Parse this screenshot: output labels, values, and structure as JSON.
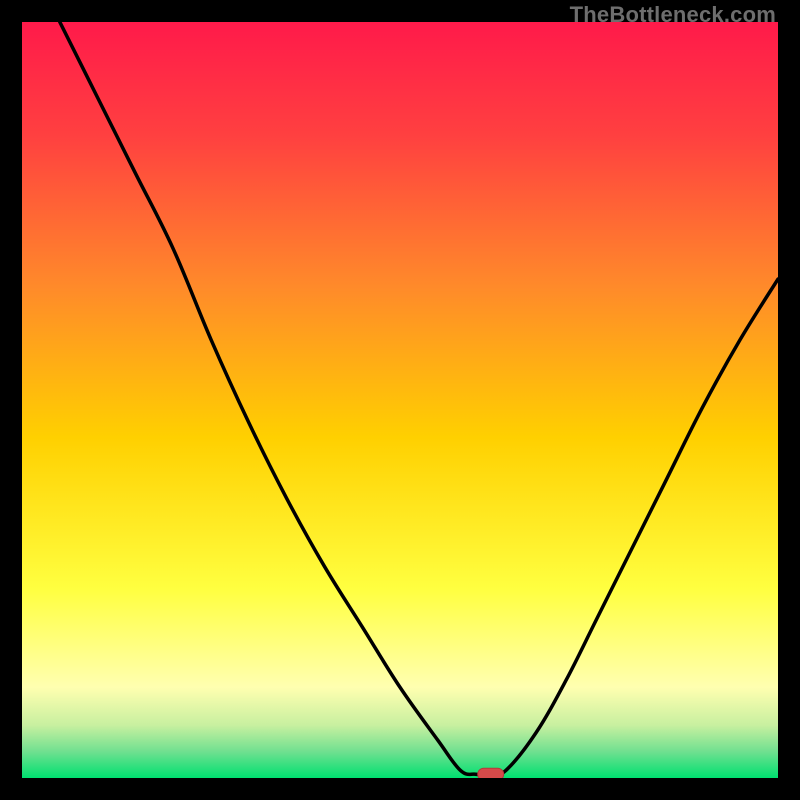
{
  "watermark": "TheBottleneck.com",
  "colors": {
    "black": "#000000",
    "curve": "#000000",
    "marker_fill": "#d64a4a",
    "marker_stroke": "#b23a3a",
    "grad_top": "#ff1a4a",
    "grad_mid1": "#ff6a3a",
    "grad_mid2": "#ffd000",
    "grad_yellow": "#ffff40",
    "grad_paleyellow": "#ffffb0",
    "grad_lightgreen": "#9de89d",
    "grad_green": "#00e070"
  },
  "chart_data": {
    "type": "line",
    "title": "",
    "xlabel": "",
    "ylabel": "",
    "xlim": [
      0,
      100
    ],
    "ylim": [
      0,
      100
    ],
    "curve": [
      {
        "x": 5,
        "y": 100
      },
      {
        "x": 10,
        "y": 90
      },
      {
        "x": 15,
        "y": 80
      },
      {
        "x": 20,
        "y": 70
      },
      {
        "x": 25,
        "y": 58
      },
      {
        "x": 30,
        "y": 47
      },
      {
        "x": 35,
        "y": 37
      },
      {
        "x": 40,
        "y": 28
      },
      {
        "x": 45,
        "y": 20
      },
      {
        "x": 50,
        "y": 12
      },
      {
        "x": 55,
        "y": 5
      },
      {
        "x": 58,
        "y": 1
      },
      {
        "x": 60,
        "y": 0.5
      },
      {
        "x": 62,
        "y": 0.5
      },
      {
        "x": 64,
        "y": 1
      },
      {
        "x": 68,
        "y": 6
      },
      {
        "x": 72,
        "y": 13
      },
      {
        "x": 76,
        "y": 21
      },
      {
        "x": 80,
        "y": 29
      },
      {
        "x": 85,
        "y": 39
      },
      {
        "x": 90,
        "y": 49
      },
      {
        "x": 95,
        "y": 58
      },
      {
        "x": 100,
        "y": 66
      }
    ],
    "marker": {
      "x": 62,
      "y": 0.5
    },
    "gradient_stops": [
      {
        "pos": 0.0,
        "color": "#ff1a4a"
      },
      {
        "pos": 0.15,
        "color": "#ff4040"
      },
      {
        "pos": 0.35,
        "color": "#ff8a2a"
      },
      {
        "pos": 0.55,
        "color": "#ffd000"
      },
      {
        "pos": 0.75,
        "color": "#ffff40"
      },
      {
        "pos": 0.88,
        "color": "#ffffb0"
      },
      {
        "pos": 0.93,
        "color": "#c8f0a0"
      },
      {
        "pos": 0.965,
        "color": "#70e090"
      },
      {
        "pos": 1.0,
        "color": "#00e070"
      }
    ]
  }
}
